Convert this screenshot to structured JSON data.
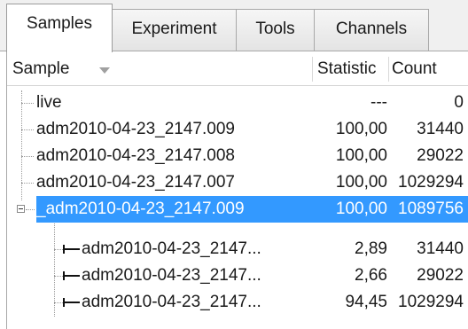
{
  "tabs": [
    {
      "label": "Samples",
      "active": true
    },
    {
      "label": "Experiment",
      "active": false
    },
    {
      "label": "Tools",
      "active": false
    },
    {
      "label": "Channels",
      "active": false
    }
  ],
  "columns": {
    "sample": "Sample",
    "statistic": "Statistic",
    "count": "Count"
  },
  "rows": [
    {
      "name": "live",
      "statistic": "---",
      "count": "0",
      "level": 0
    },
    {
      "name": "adm2010-04-23_2147.009",
      "statistic": "100,00",
      "count": "31440",
      "level": 0
    },
    {
      "name": "adm2010-04-23_2147.008",
      "statistic": "100,00",
      "count": "29022",
      "level": 0
    },
    {
      "name": "adm2010-04-23_2147.007",
      "statistic": "100,00",
      "count": "1029294",
      "level": 0
    },
    {
      "name": "_adm2010-04-23_2147.009",
      "statistic": "100,00",
      "count": "1089756",
      "level": 0,
      "expanded": true,
      "selected": true
    },
    {
      "name": "adm2010-04-23_2147...",
      "statistic": "2,89",
      "count": "31440",
      "level": 1
    },
    {
      "name": "adm2010-04-23_2147...",
      "statistic": "2,66",
      "count": "29022",
      "level": 1
    },
    {
      "name": "adm2010-04-23_2147...",
      "statistic": "94,45",
      "count": "1029294",
      "level": 1
    }
  ],
  "icons": {
    "sort": "sort-descending-arrow-icon",
    "expander": "collapse-minus-icon",
    "gate": "range-gate-icon"
  },
  "colors": {
    "selection": "#3399ff",
    "tab_border": "#a8a8a8"
  }
}
